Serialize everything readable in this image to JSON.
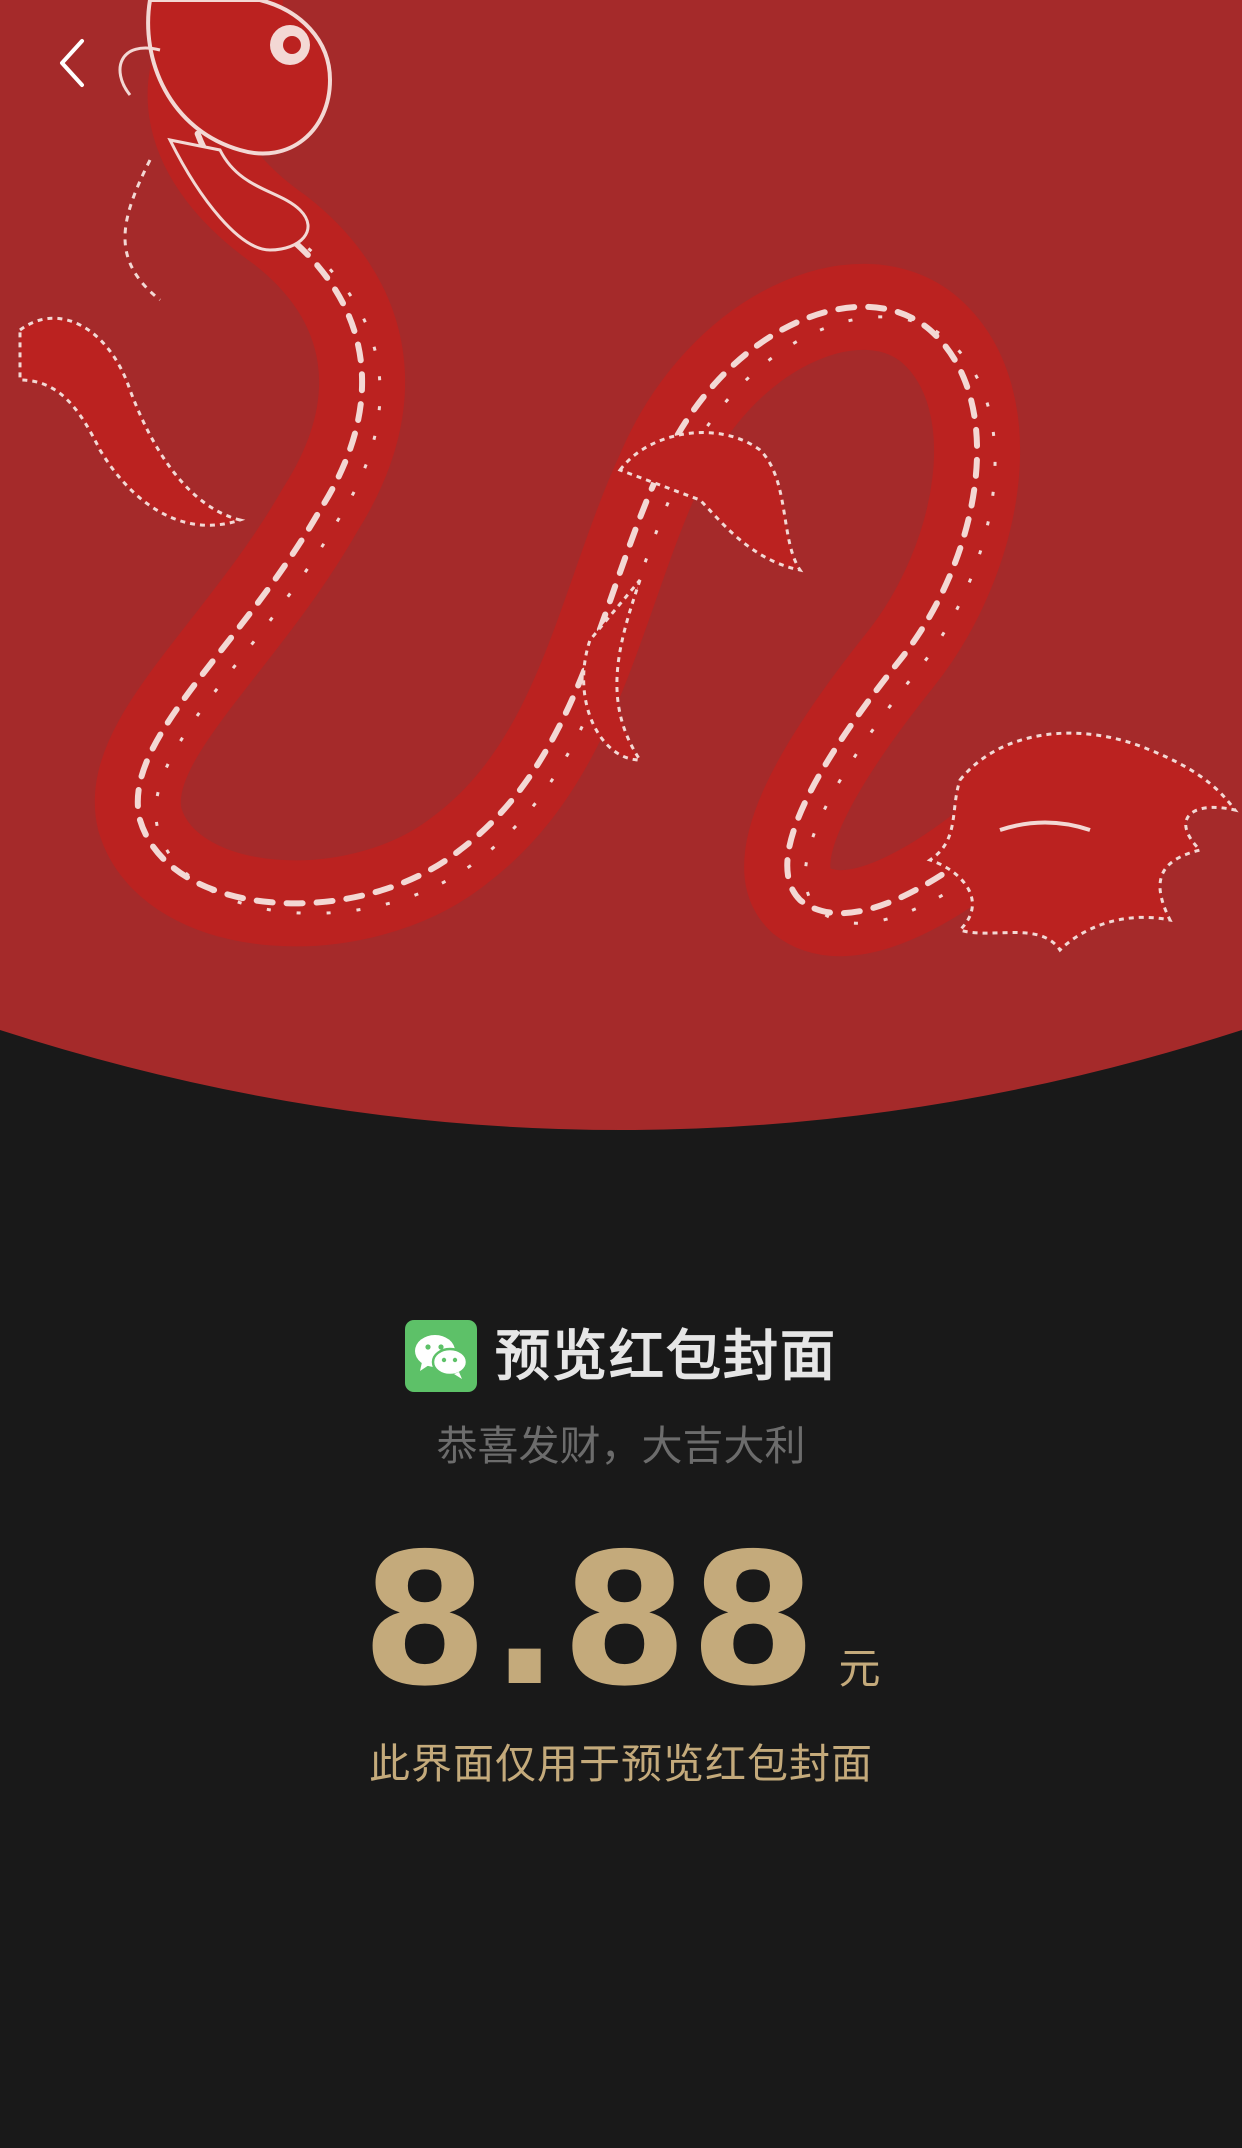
{
  "colors": {
    "page_background": "#191919",
    "cover_red": "#a52a2a",
    "dragon_red": "#bb2220",
    "dragon_outline": "#f3d8d4",
    "gold": "#c4aa7b",
    "wechat_green": "#5dc168"
  },
  "header": {
    "back_icon": "chevron-left-icon"
  },
  "cover": {
    "illustration": "dragon-illustration"
  },
  "envelope": {
    "app_icon": "wechat-icon",
    "title": "预览红包封面",
    "subtitle": "恭喜发财，大吉大利",
    "amount": "8.88",
    "unit": "元",
    "note": "此界面仅用于预览红包封面"
  }
}
